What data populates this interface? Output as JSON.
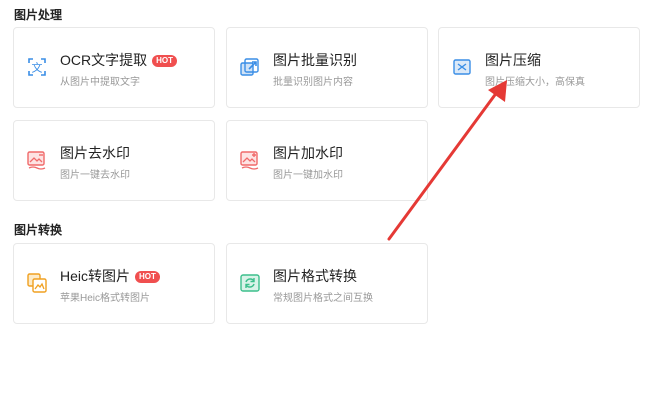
{
  "sections": {
    "image_processing": {
      "title": "图片处理",
      "cards": [
        {
          "title": "OCR文字提取",
          "badge": "HOT",
          "desc": "从图片中提取文字",
          "icon": "text-recognition-icon"
        },
        {
          "title": "图片批量识别",
          "desc": "批量识别图片内容",
          "icon": "batch-export-icon"
        },
        {
          "title": "图片压缩",
          "desc": "图片压缩大小，高保真",
          "icon": "compress-icon"
        },
        {
          "title": "图片去水印",
          "desc": "图片一键去水印",
          "icon": "remove-watermark-icon"
        },
        {
          "title": "图片加水印",
          "desc": "图片一键加水印",
          "icon": "add-watermark-icon"
        }
      ]
    },
    "image_conversion": {
      "title": "图片转换",
      "cards": [
        {
          "title": "Heic转图片",
          "badge": "HOT",
          "desc": "苹果Heic格式转图片",
          "icon": "heic-convert-icon"
        },
        {
          "title": "图片格式转换",
          "desc": "常规图片格式之间互换",
          "icon": "format-convert-icon"
        }
      ]
    }
  },
  "colors": {
    "badge": "#f04f4f",
    "arrow": "#e53935",
    "icon_blue": "#3a8ee6",
    "icon_red": "#f06a6a",
    "icon_orange": "#f0a020",
    "icon_green": "#3cbf8c"
  }
}
